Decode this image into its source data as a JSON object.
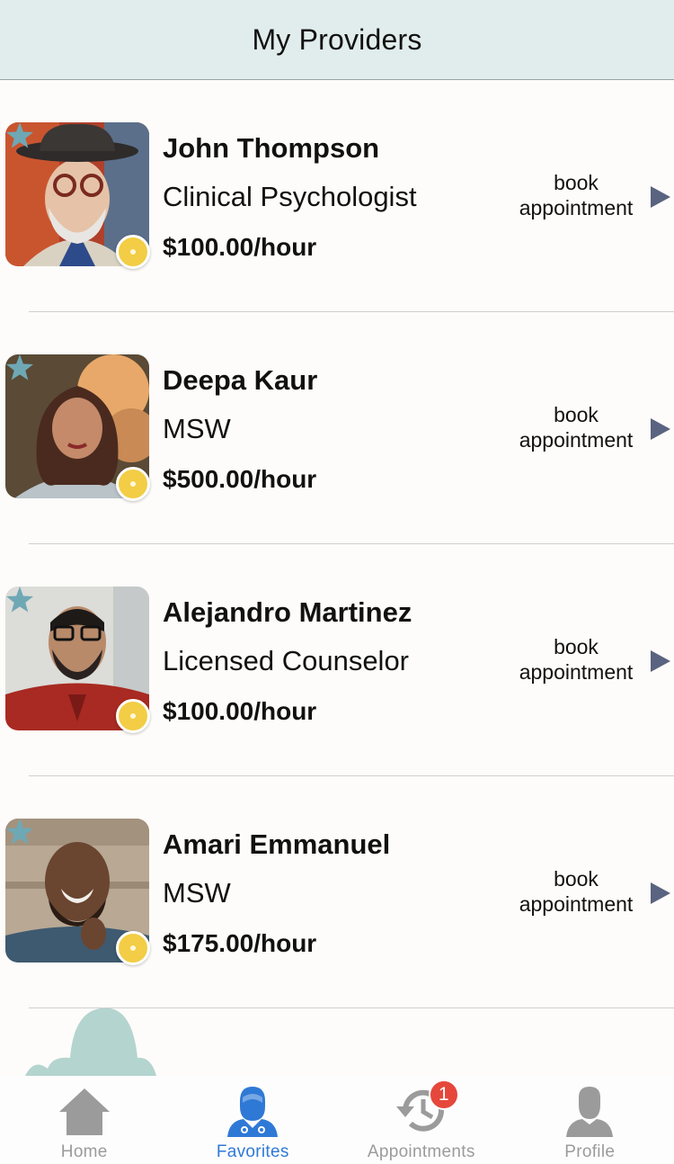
{
  "header": {
    "title": "My Providers"
  },
  "providers": [
    {
      "name": "John Thompson",
      "title": "Clinical Psychologist",
      "rate": "$100.00/hour",
      "action": "book appointment"
    },
    {
      "name": "Deepa Kaur",
      "title": "MSW",
      "rate": "$500.00/hour",
      "action": "book appointment"
    },
    {
      "name": "Alejandro Martinez",
      "title": "Licensed Counselor",
      "rate": "$100.00/hour",
      "action": "book appointment"
    },
    {
      "name": "Amari Emmanuel",
      "title": "MSW",
      "rate": "$175.00/hour",
      "action": "book appointment"
    }
  ],
  "tabs": [
    {
      "label": "Home",
      "icon": "home-icon"
    },
    {
      "label": "Favorites",
      "icon": "doctor-icon",
      "active": true
    },
    {
      "label": "Appointments",
      "icon": "history-icon",
      "badge": "1"
    },
    {
      "label": "Profile",
      "icon": "person-icon"
    }
  ],
  "colors": {
    "header_bg": "#e1ecec",
    "accent": "#2f79d6",
    "star": "#6fa8b5",
    "status": "#f2cd45",
    "badge": "#e5473b",
    "arrow": "#5a6380"
  }
}
